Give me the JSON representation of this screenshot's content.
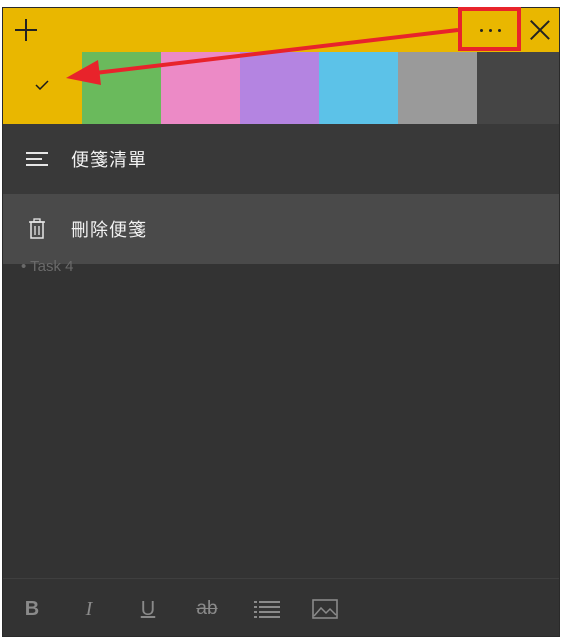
{
  "header": {
    "add_icon": "plus-icon",
    "menu_icon": "ellipsis-icon",
    "close_icon": "close-icon",
    "accent_color": "#e9b700"
  },
  "color_swatches": [
    {
      "name": "yellow",
      "color": "#e9b700",
      "selected": true
    },
    {
      "name": "green",
      "color": "#6aba5c"
    },
    {
      "name": "pink",
      "color": "#ec8ac6"
    },
    {
      "name": "purple",
      "color": "#b484e1"
    },
    {
      "name": "blue",
      "color": "#5cc2e8"
    },
    {
      "name": "gray",
      "color": "#9a9a9a"
    },
    {
      "name": "charcoal",
      "color": "#454545"
    }
  ],
  "menu": {
    "notes_list_label": "便箋清單",
    "delete_note_label": "刪除便箋"
  },
  "note": {
    "partial_text": "• Task 4"
  },
  "toolbar": {
    "bold": "B",
    "italic": "I",
    "underline": "U",
    "strikethrough": "ab"
  },
  "annotation": {
    "highlight_color": "#e8232b"
  }
}
